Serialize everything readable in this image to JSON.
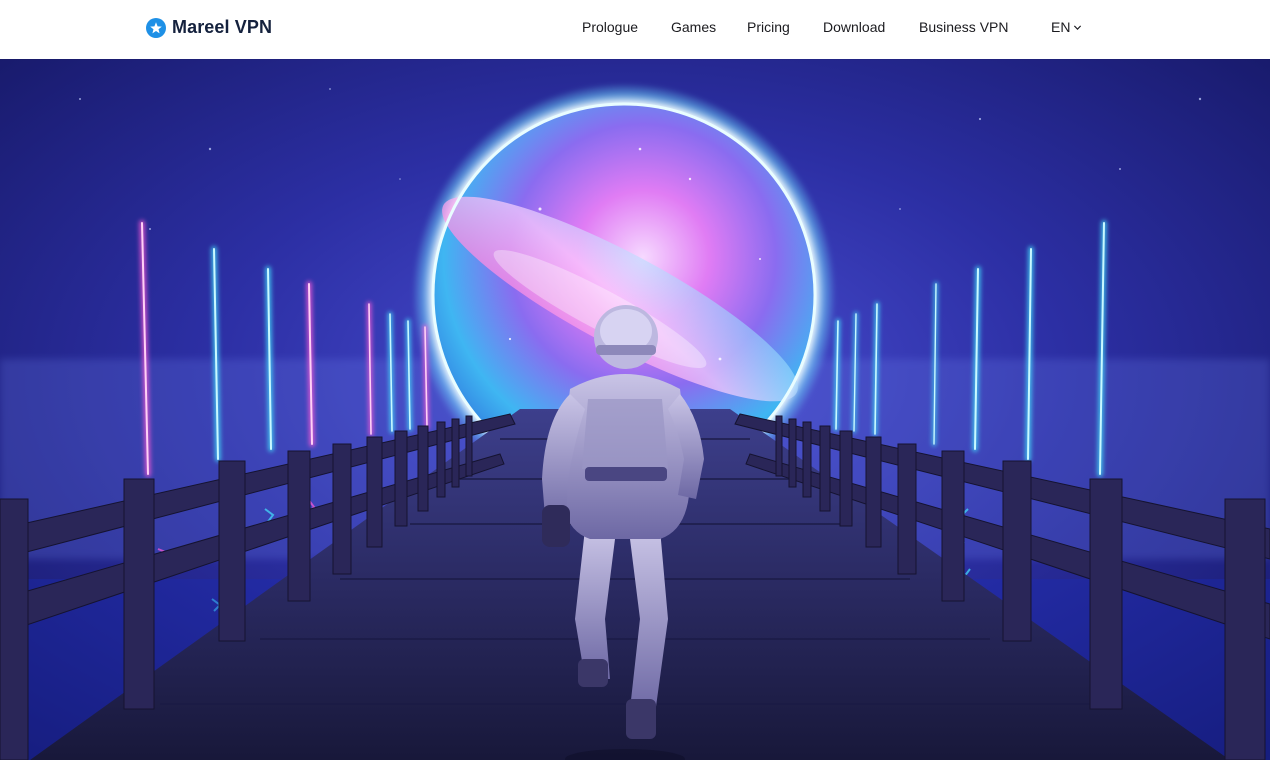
{
  "brand": {
    "name": "Mareel VPN",
    "logo_icon": "mareel-logo-icon",
    "color": "#14213d",
    "icon_color": "#1e90e6"
  },
  "nav": {
    "items": [
      {
        "label": "Prologue"
      },
      {
        "label": "Games"
      },
      {
        "label": "Pricing"
      },
      {
        "label": "Download"
      },
      {
        "label": "Business VPN"
      }
    ],
    "language": {
      "label": "EN",
      "icon": "chevron-down-icon"
    }
  },
  "hero": {
    "image": "astronaut-running-on-neon-bridge-toward-galaxy-portal",
    "palette": {
      "sky": "#2a2c9a",
      "portal_ring": "#7fe8ff",
      "neon_pink": "#ff5ad9",
      "neon_cyan": "#44e4ff"
    }
  }
}
